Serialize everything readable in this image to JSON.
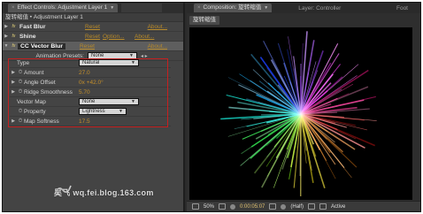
{
  "effect_controls": {
    "tab_title": "Effect Controls: Adjustment Layer 1",
    "breadcrumb": "旋转缩值 • Adjustment Layer 1",
    "effects": [
      {
        "name": "Fast Blur",
        "reset": "Reset",
        "about": "About..."
      },
      {
        "name": "Shine",
        "reset": "Reset",
        "options": "Option...",
        "about": "About..."
      },
      {
        "name": "CC Vector Blur",
        "reset": "Reset",
        "about": "About..."
      }
    ],
    "animation_presets": {
      "label": "Animation Presets:",
      "value": "None"
    },
    "params": {
      "type": {
        "label": "Type",
        "value": "Natural"
      },
      "amount": {
        "label": "Amount",
        "value": "27.0"
      },
      "angle_offset": {
        "label": "Angle Offset",
        "value": "0x +42.0°"
      },
      "ridge_smoothness": {
        "label": "Ridge Smoothness",
        "value": "5.70"
      },
      "vector_map": {
        "label": "Vector Map",
        "value": "None"
      },
      "property": {
        "label": "Property",
        "value": "Lightness"
      },
      "map_softness": {
        "label": "Map Softness",
        "value": "17.5"
      }
    },
    "watermark": "吴飞 wq.fei.blog.163.com"
  },
  "composition": {
    "tab_title": "Composition: 旋转缩值",
    "layer_tab": "Layer: Controller",
    "foot_tab": "Foot",
    "comp_name": "旋转缩值",
    "status": {
      "zoom": "50%",
      "timecode": "0:00:05:07",
      "resolution": "(Half)",
      "active": "Active"
    }
  },
  "colors": {
    "highlight_box": "#c62020",
    "value_orange": "#c48f2a",
    "panel_bg": "#444444",
    "canvas_bg": "#000000"
  }
}
